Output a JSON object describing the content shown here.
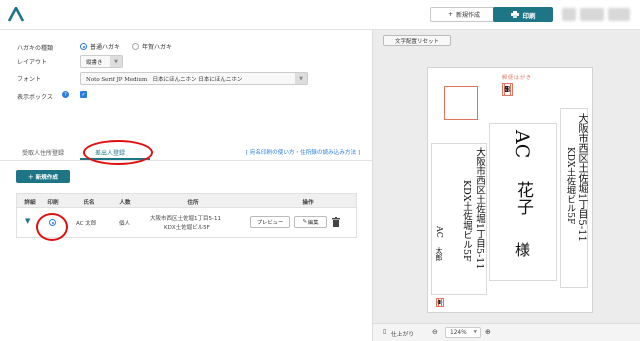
{
  "header": {
    "new_label": "新規作成",
    "print_label": "印刷",
    "brand_color": "#1e7586"
  },
  "form": {
    "hagaki_type_label": "ハガキの種類",
    "option_normal": "普通ハガキ",
    "option_nenga": "年賀ハガキ",
    "layout_label": "レイアウト",
    "layout_value": "縦書き",
    "font_label": "フォント",
    "font_value": "Noto Serif JP Medium　日本にほんニホン 日本にほんニホン",
    "display_box_label": "表示ボックス"
  },
  "tabs": {
    "receiver": "受取人住所登録",
    "sender": "差出人登録",
    "help_link": "[ 宛名印刷の使い方・住所録の読み込み方法 ]"
  },
  "add_button_label": "＋ 新規作成",
  "table": {
    "headers": [
      "詳細",
      "印刷",
      "氏名",
      "人数",
      "住所",
      "操作"
    ],
    "row": {
      "name": "AC 太郎",
      "count": "個人",
      "address_line1": "大阪市西区土佐堀1丁目5-11",
      "address_line2": "KDX土佐堀ビル5F",
      "preview_label": "プレビュー",
      "edit_label": "編集"
    }
  },
  "preview": {
    "layout_reset_label": "文字配置リセット",
    "postcard_title": "郵便はがき",
    "recipient_zip": [
      "5",
      "5",
      "0",
      "0",
      "0",
      "0",
      "1"
    ],
    "recipient_address": "大阪市西区土佐堀1丁目5-11",
    "recipient_building": "KDX土佐堀ビル5F",
    "recipient_lastname": "AC",
    "recipient_firstname": "花子",
    "honorific": "様",
    "sender_address": "大阪市西区土佐堀1丁目5-11",
    "sender_building": "KDX土佐堀ビル5F",
    "sender_name_last": "AC",
    "sender_name_first": "太郎",
    "sender_zip": [
      "5",
      "5",
      "0",
      "0",
      "0",
      "0",
      "1"
    ],
    "finish_label": "仕上がり",
    "zoom_value": "124%"
  }
}
